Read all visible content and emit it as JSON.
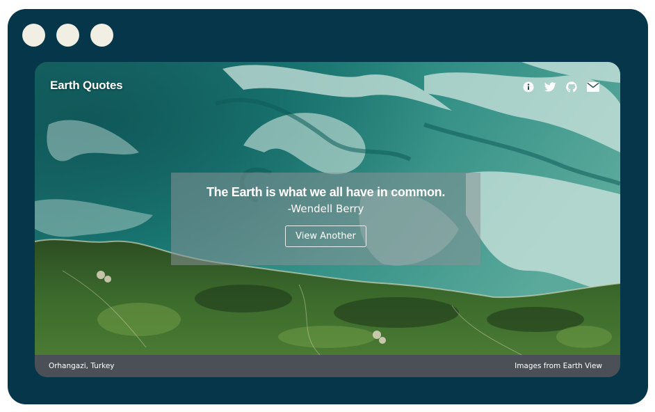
{
  "header": {
    "title": "Earth Quotes",
    "icons": [
      "info-icon",
      "twitter-icon",
      "github-icon",
      "envelope-icon"
    ]
  },
  "quote": {
    "text": "The Earth is what we all have in common.",
    "author": "-Wendell Berry",
    "button_label": "View Another"
  },
  "footer": {
    "location": "Orhangazi, Turkey",
    "credit": "Images from Earth View"
  },
  "colors": {
    "frame": "#06364a",
    "window_dots": "#f1eee4",
    "footer": "#4a5056",
    "sea": "#1b7b74",
    "land": "#3c6b2c"
  }
}
